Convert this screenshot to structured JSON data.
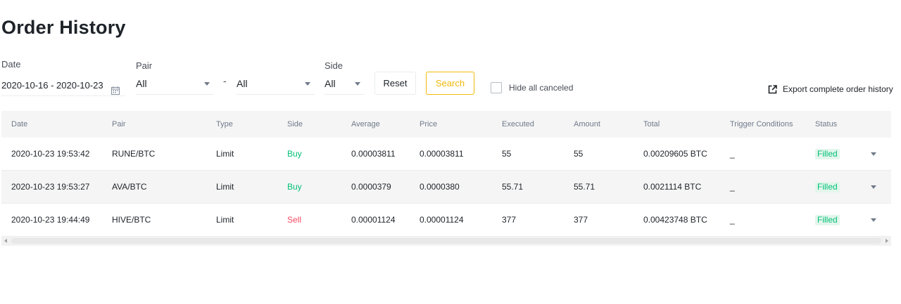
{
  "page": {
    "title": "Order History"
  },
  "filters": {
    "date_label": "Date",
    "date_value": "2020-10-16 - 2020-10-23",
    "pair_label": "Pair",
    "pair_base": "All",
    "pair_separator": "-",
    "pair_quote": "All",
    "side_label": "Side",
    "side_value": "All",
    "reset_label": "Reset",
    "search_label": "Search",
    "hide_canceled_label": "Hide all canceled",
    "hide_canceled_checked": false,
    "export_label": "Export complete order history"
  },
  "table": {
    "headers": [
      "Date",
      "Pair",
      "Type",
      "Side",
      "Average",
      "Price",
      "Executed",
      "Amount",
      "Total",
      "Trigger Conditions",
      "Status"
    ],
    "rows": [
      {
        "date": "2020-10-23 19:53:42",
        "pair": "RUNE/BTC",
        "type": "Limit",
        "side": "Buy",
        "average": "0.00003811",
        "price": "0.00003811",
        "executed": "55",
        "amount": "55",
        "total": "0.00209605 BTC",
        "trigger": "_",
        "status": "Filled"
      },
      {
        "date": "2020-10-23 19:53:27",
        "pair": "AVA/BTC",
        "type": "Limit",
        "side": "Buy",
        "average": "0.0000379",
        "price": "0.0000380",
        "executed": "55.71",
        "amount": "55.71",
        "total": "0.0021114 BTC",
        "trigger": "_",
        "status": "Filled"
      },
      {
        "date": "2020-10-23 19:44:49",
        "pair": "HIVE/BTC",
        "type": "Limit",
        "side": "Sell",
        "average": "0.00001124",
        "price": "0.00001124",
        "executed": "377",
        "amount": "377",
        "total": "0.00423748 BTC",
        "trigger": "_",
        "status": "Filled"
      }
    ]
  },
  "colors": {
    "buy": "#02c076",
    "sell": "#f84960",
    "accent": "#f0b90b",
    "status_filled_bg": "#e3f6ec"
  },
  "icons": {
    "calendar": "calendar-icon",
    "export": "external-link-icon",
    "expand": "chevron-down-icon"
  }
}
